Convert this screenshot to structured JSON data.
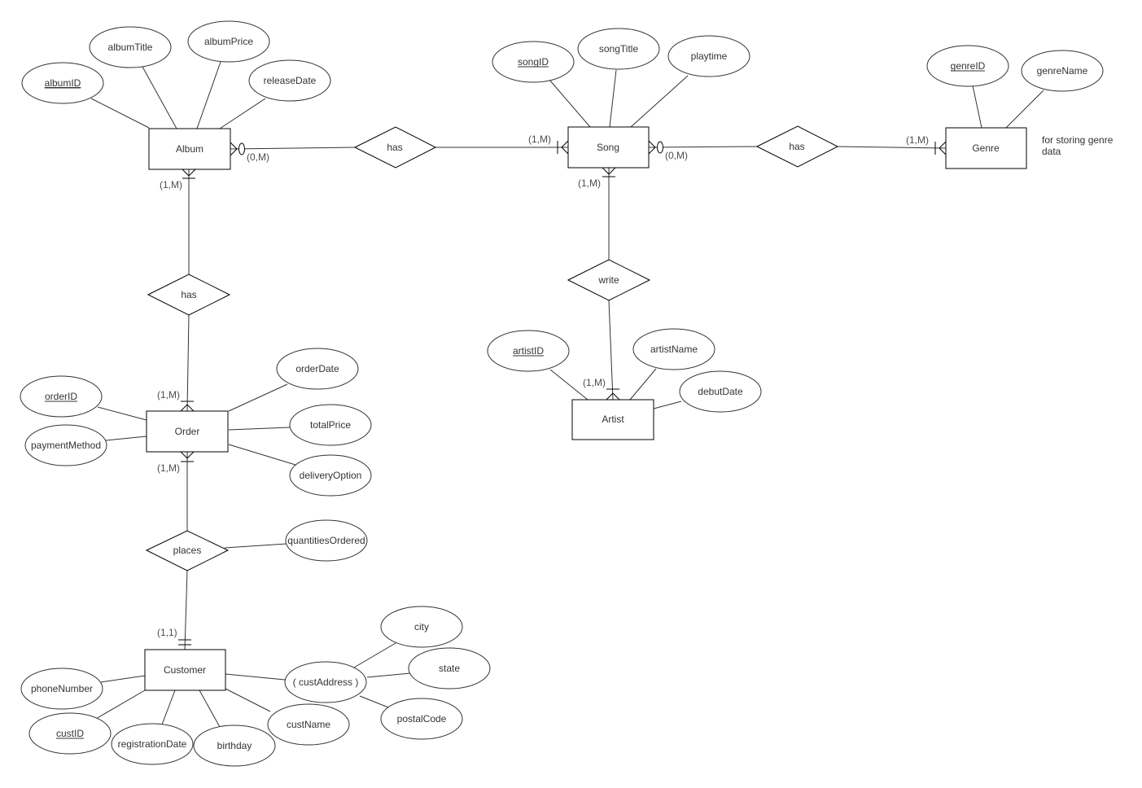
{
  "diagram": {
    "type": "er-diagram",
    "colors": {
      "stroke": "#000000",
      "line": "#333333",
      "text": "#333333",
      "background": "#ffffff"
    },
    "entities": [
      {
        "id": "album",
        "label": "Album"
      },
      {
        "id": "song",
        "label": "Song"
      },
      {
        "id": "genre",
        "label": "Genre"
      },
      {
        "id": "order",
        "label": "Order"
      },
      {
        "id": "artist",
        "label": "Artist"
      },
      {
        "id": "customer",
        "label": "Customer"
      }
    ],
    "relationships": [
      {
        "id": "album-song",
        "label": "has"
      },
      {
        "id": "song-genre",
        "label": "has"
      },
      {
        "id": "album-order",
        "label": "has"
      },
      {
        "id": "song-artist",
        "label": "write"
      },
      {
        "id": "order-customer",
        "label": "places"
      }
    ],
    "attributes": [
      {
        "id": "albumID",
        "label": "albumID",
        "key": true,
        "owner": "album"
      },
      {
        "id": "albumTitle",
        "label": "albumTitle",
        "key": false,
        "owner": "album"
      },
      {
        "id": "albumPrice",
        "label": "albumPrice",
        "key": false,
        "owner": "album"
      },
      {
        "id": "releaseDate",
        "label": "releaseDate",
        "key": false,
        "owner": "album"
      },
      {
        "id": "songID",
        "label": "songID",
        "key": true,
        "owner": "song"
      },
      {
        "id": "songTitle",
        "label": "songTitle",
        "key": false,
        "owner": "song"
      },
      {
        "id": "playtime",
        "label": "playtime",
        "key": false,
        "owner": "song"
      },
      {
        "id": "genreID",
        "label": "genreID",
        "key": true,
        "owner": "genre"
      },
      {
        "id": "genreName",
        "label": "genreName",
        "key": false,
        "owner": "genre"
      },
      {
        "id": "orderID",
        "label": "orderID",
        "key": true,
        "owner": "order"
      },
      {
        "id": "paymentMethod",
        "label": "paymentMethod",
        "key": false,
        "owner": "order"
      },
      {
        "id": "orderDate",
        "label": "orderDate",
        "key": false,
        "owner": "order"
      },
      {
        "id": "totalPrice",
        "label": "totalPrice",
        "key": false,
        "owner": "order"
      },
      {
        "id": "deliveryOption",
        "label": "deliveryOption",
        "key": false,
        "owner": "order"
      },
      {
        "id": "artistID",
        "label": "artistID",
        "key": true,
        "owner": "artist"
      },
      {
        "id": "artistName",
        "label": "artistName",
        "key": false,
        "owner": "artist"
      },
      {
        "id": "debutDate",
        "label": "debutDate",
        "key": false,
        "owner": "artist"
      },
      {
        "id": "quantitiesOrdered",
        "label": "quantitiesOrdered",
        "key": false,
        "owner": "order-customer"
      },
      {
        "id": "phoneNumber",
        "label": "phoneNumber",
        "key": false,
        "owner": "customer"
      },
      {
        "id": "custID",
        "label": "custID",
        "key": true,
        "owner": "customer"
      },
      {
        "id": "registrationDate",
        "label": "registrationDate",
        "key": false,
        "owner": "customer"
      },
      {
        "id": "birthday",
        "label": "birthday",
        "key": false,
        "owner": "customer"
      },
      {
        "id": "custName",
        "label": "custName",
        "key": false,
        "owner": "customer"
      },
      {
        "id": "custAddress",
        "label": "( custAddress )",
        "key": false,
        "owner": "customer"
      },
      {
        "id": "city",
        "label": "city",
        "key": false,
        "owner": "custAddress"
      },
      {
        "id": "state",
        "label": "state",
        "key": false,
        "owner": "custAddress"
      },
      {
        "id": "postalCode",
        "label": "postalCode",
        "key": false,
        "owner": "custAddress"
      }
    ],
    "cardinalities": [
      {
        "id": "album-right",
        "label": "(0,M)",
        "notation": "zero-or-many"
      },
      {
        "id": "album-bottom",
        "label": "(1,M)",
        "notation": "one-or-many"
      },
      {
        "id": "song-left",
        "label": "(1,M)",
        "notation": "one-or-many"
      },
      {
        "id": "song-right",
        "label": "(0,M)",
        "notation": "zero-or-many"
      },
      {
        "id": "song-bottom",
        "label": "(1,M)",
        "notation": "one-or-many"
      },
      {
        "id": "genre-left",
        "label": "(1,M)",
        "notation": "one-or-many"
      },
      {
        "id": "order-top",
        "label": "(1,M)",
        "notation": "one-or-many"
      },
      {
        "id": "order-bottom",
        "label": "(1,M)",
        "notation": "one-or-many"
      },
      {
        "id": "artist-top",
        "label": "(1,M)",
        "notation": "one-or-many"
      },
      {
        "id": "customer-top",
        "label": "(1,1)",
        "notation": "one-and-only-one"
      }
    ],
    "notes": [
      {
        "id": "genre-note",
        "lines": [
          "for storing genre",
          "data"
        ]
      }
    ]
  }
}
